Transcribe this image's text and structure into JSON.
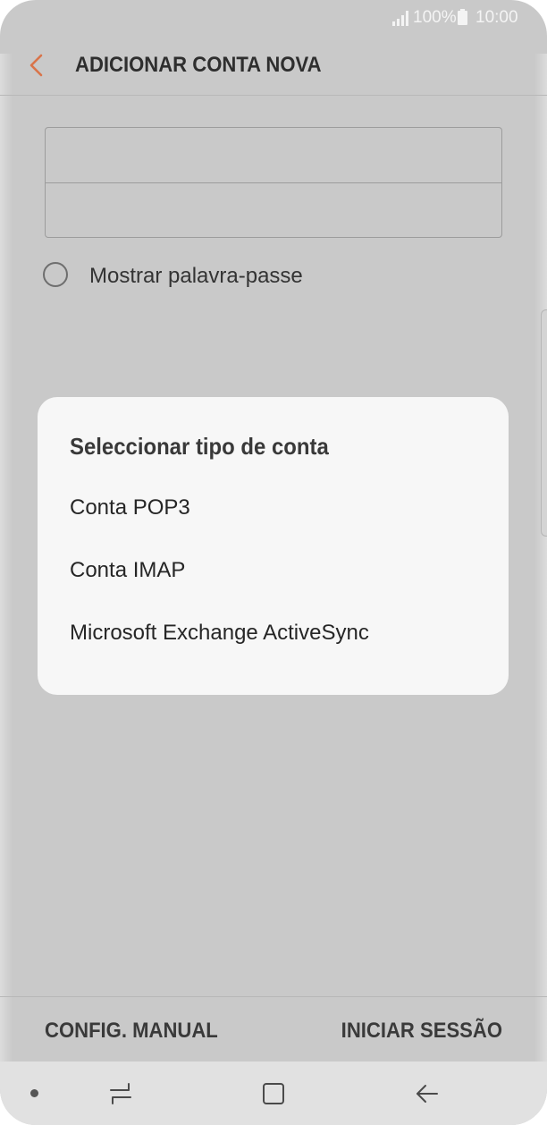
{
  "status_bar": {
    "battery_percent": "100%",
    "time": "10:00",
    "signal_icon": "signal-icon",
    "battery_icon": "battery-icon"
  },
  "header": {
    "title": "ADICIONAR CONTA NOVA",
    "back_icon": "chevron-left-icon",
    "accent_color": "#d9744a"
  },
  "form": {
    "email_value": "",
    "password_value": "",
    "show_password_label": "Mostrar palavra-passe",
    "show_password_checked": false
  },
  "dialog": {
    "title": "Seleccionar tipo de conta",
    "options": [
      {
        "label": "Conta POP3"
      },
      {
        "label": "Conta IMAP"
      },
      {
        "label": "Microsoft Exchange ActiveSync"
      }
    ]
  },
  "actions": {
    "manual_setup": "CONFIG. MANUAL",
    "sign_in": "INICIAR SESSÃO"
  },
  "nav_bar": {
    "icons": [
      "recent-apps-icon",
      "home-icon",
      "back-icon"
    ]
  }
}
